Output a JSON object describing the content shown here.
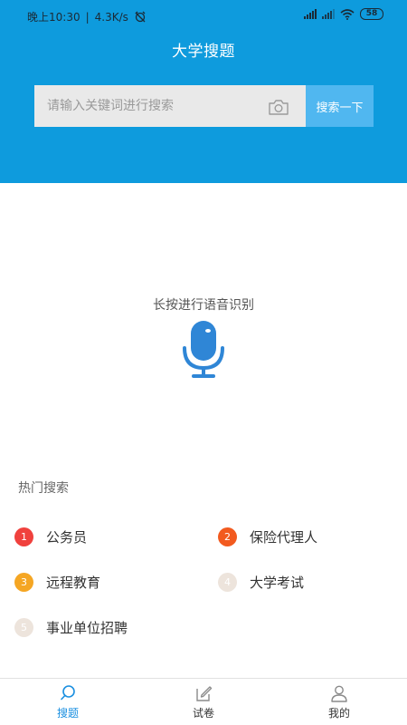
{
  "status_bar": {
    "time": "晚上10:30",
    "separator": "|",
    "speed": "4.3K/s",
    "battery": "58"
  },
  "header": {
    "title": "大学搜题"
  },
  "search": {
    "placeholder": "请输入关键词进行搜索",
    "button_label": "搜索一下"
  },
  "voice": {
    "hint": "长按进行语音识别"
  },
  "hot_search": {
    "title": "热门搜索",
    "items": [
      {
        "rank": "1",
        "label": "公务员",
        "color": "#f0413d"
      },
      {
        "rank": "2",
        "label": "保险代理人",
        "color": "#f25a1f"
      },
      {
        "rank": "3",
        "label": "远程教育",
        "color": "#f5a623"
      },
      {
        "rank": "4",
        "label": "大学考试",
        "color": "#ede4dc"
      },
      {
        "rank": "5",
        "label": "事业单位招聘",
        "color": "#ede4dc"
      }
    ]
  },
  "tabs": [
    {
      "label": "搜题",
      "icon": "search-icon",
      "active": true
    },
    {
      "label": "试卷",
      "icon": "edit-icon",
      "active": false
    },
    {
      "label": "我的",
      "icon": "user-icon",
      "active": false
    }
  ],
  "colors": {
    "header": "#0e9bdd",
    "search_button": "#50b7f0",
    "accent": "#1a8fe0",
    "mic": "#2f86d6"
  }
}
